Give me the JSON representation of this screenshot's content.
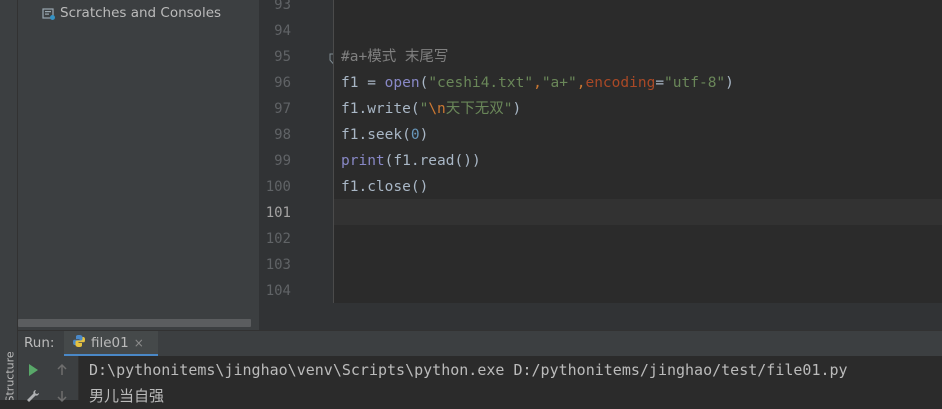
{
  "project": {
    "items": [
      {
        "label": "Scratches and Consoles",
        "icon": "scratches-icon"
      }
    ]
  },
  "editor": {
    "line_numbers": [
      "93",
      "94",
      "95",
      "96",
      "97",
      "98",
      "99",
      "100",
      "101",
      "102",
      "103",
      "104"
    ],
    "current_line": "101",
    "code": {
      "line95": {
        "comment": "#a+模式 末尾写"
      },
      "line96": {
        "var": "f1 = ",
        "fn": "open",
        "p1": "(",
        "s1": "\"ceshi4.txt\"",
        "comma1": ",",
        "s2": "\"a+\"",
        "comma2": ",",
        "kw": "encoding",
        "eq": "=",
        "s3": "\"utf-8\"",
        "p2": ")"
      },
      "line97": {
        "obj": "f1.write(",
        "q1": "\"",
        "esc": "\\n",
        "text": "天下无双",
        "q2": "\"",
        "close": ")"
      },
      "line98": {
        "obj": "f1.seek(",
        "num": "0",
        "close": ")"
      },
      "line99": {
        "fn": "print",
        "rest": "(f1.read())"
      },
      "line100": {
        "text": "f1.close()"
      }
    }
  },
  "run": {
    "label": "Run:",
    "tab_label": "file01",
    "tab_close": "×",
    "output": [
      "D:\\pythonitems\\jinghao\\venv\\Scripts\\python.exe D:/pythonitems/jinghao/test/file01.py",
      "男儿当自强"
    ]
  },
  "sidebar": {
    "structure_label": "Structure"
  },
  "colors": {
    "background": "#2b2b2b",
    "panel": "#3c3f41",
    "string": "#6a8759",
    "keyword": "#cc7832",
    "builtin": "#8888c6",
    "number": "#6897bb",
    "run_green": "#59a869"
  }
}
